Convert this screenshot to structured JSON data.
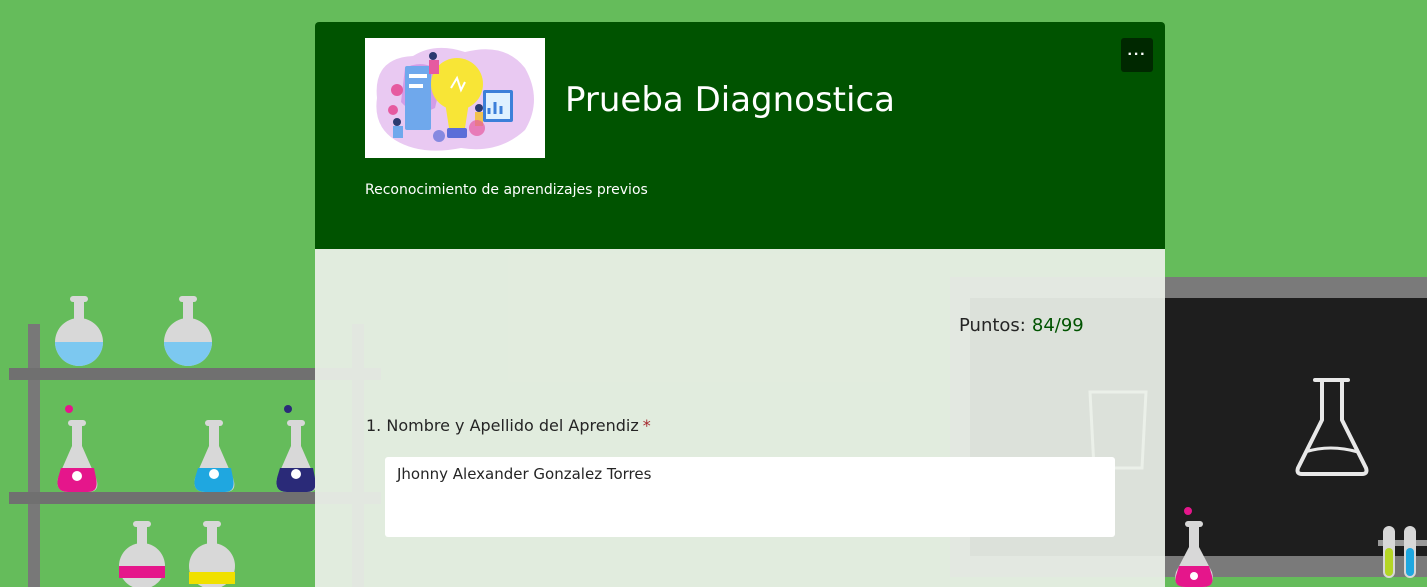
{
  "form": {
    "title": "Prueba Diagnostica",
    "subtitle": "Reconocimiento de aprendizajes previos",
    "more_label": "···",
    "logo": "lightbulb-idea-illustration",
    "header_color": "#005300"
  },
  "score": {
    "label": "Puntos:",
    "value": "84/99"
  },
  "questions": [
    {
      "number": "1.",
      "text": "Nombre y Apellido del Aprendiz",
      "required_mark": "*",
      "answer": "Jhonny Alexander Gonzalez Torres"
    }
  ],
  "theme": {
    "background": "#65bc5b",
    "accent": "#005300",
    "required": "#a4262c"
  }
}
